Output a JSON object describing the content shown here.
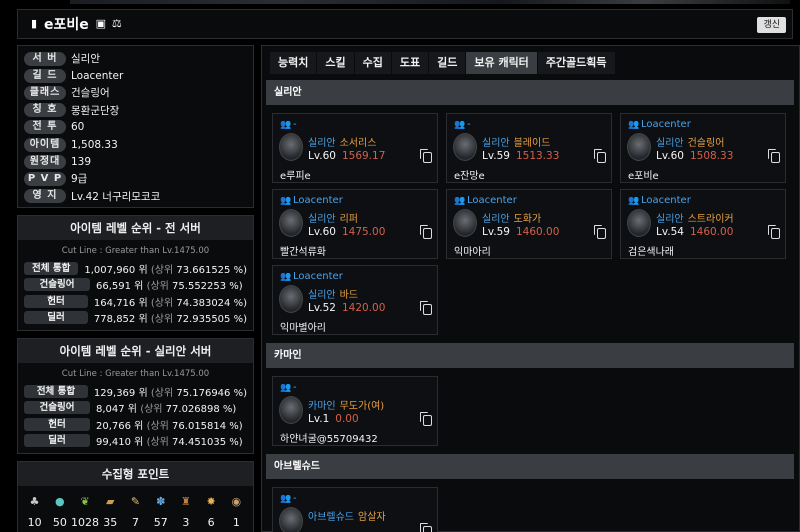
{
  "header": {
    "name": "e포비e",
    "refresh_label": "갱신"
  },
  "info": [
    {
      "key": "서 버",
      "value": "실리안"
    },
    {
      "key": "길 드",
      "value": "Loacenter"
    },
    {
      "key": "클래스",
      "value": "건슬링어"
    },
    {
      "key": "칭 호",
      "value": "몽환군단장"
    },
    {
      "key": "전 투",
      "value": "60"
    },
    {
      "key": "아이템",
      "value": "1,508.33"
    },
    {
      "key": "원정대",
      "value": "139"
    },
    {
      "key": "P V P",
      "value": "9급"
    },
    {
      "key": "영 지",
      "value": "Lv.42 너구리모코코"
    }
  ],
  "rank_all": {
    "title": "아이템 레벨 순위 - 전 서버",
    "cut": "Cut Line : Greater than Lv.1475.00",
    "rows": [
      {
        "key": "전체 통합",
        "rank": "1,007,960 위",
        "sub": "(상위",
        "pct": "73.661525 %)"
      },
      {
        "key": "건슬링어",
        "rank": "66,591 위",
        "sub": "(상위",
        "pct": "75.552253 %)"
      },
      {
        "key": "헌터",
        "rank": "164,716 위",
        "sub": "(상위",
        "pct": "74.383024 %)"
      },
      {
        "key": "딜러",
        "rank": "778,852 위",
        "sub": "(상위",
        "pct": "72.935505 %)"
      }
    ]
  },
  "rank_server": {
    "title": "아이템 레벨 순위 - 실리안 서버",
    "cut": "Cut Line : Greater than Lv.1475.00",
    "rows": [
      {
        "key": "전체 통합",
        "rank": "129,369 위",
        "sub": "(상위",
        "pct": "75.176946 %)"
      },
      {
        "key": "건슬링어",
        "rank": "8,047 위",
        "sub": "(상위",
        "pct": "77.026898 %)"
      },
      {
        "key": "헌터",
        "rank": "20,766 위",
        "sub": "(상위",
        "pct": "76.015814 %)"
      },
      {
        "key": "딜러",
        "rank": "99,410 위",
        "sub": "(상위",
        "pct": "74.451035 %)"
      }
    ]
  },
  "collect": {
    "title": "수집형 포인트",
    "items": [
      {
        "icon": "mokoko-seed-icon",
        "count": "10",
        "color": "#c8c8c8"
      },
      {
        "icon": "island-heart-icon",
        "count": "50",
        "color": "#5cc6c0"
      },
      {
        "icon": "giant-heart-icon",
        "count": "1028",
        "color": "#8ac04a"
      },
      {
        "icon": "art-icon",
        "count": "35",
        "color": "#c9a050"
      },
      {
        "icon": "voyage-icon",
        "count": "7",
        "color": "#e0c070"
      },
      {
        "icon": "world-tree-leaf-icon",
        "count": "57",
        "color": "#6ab0e8"
      },
      {
        "icon": "ignea-token-icon",
        "count": "3",
        "color": "#c08040"
      },
      {
        "icon": "orpheus-star-icon",
        "count": "6",
        "color": "#e8b050"
      },
      {
        "icon": "medal-icon",
        "count": "1",
        "color": "#c8a070"
      }
    ]
  },
  "tabs": [
    {
      "label": "능력치",
      "active": false
    },
    {
      "label": "스킬",
      "active": false
    },
    {
      "label": "수집",
      "active": false
    },
    {
      "label": "도표",
      "active": false
    },
    {
      "label": "길드",
      "active": false
    },
    {
      "label": "보유 캐릭터",
      "active": true
    },
    {
      "label": "주간골드획득",
      "active": false
    }
  ],
  "servers": [
    {
      "name": "실리안",
      "characters": [
        {
          "guild": "-",
          "server": "실리안",
          "class": "소서리스",
          "level": "Lv.60",
          "ilvl": "1569.17",
          "name": "e루피e"
        },
        {
          "guild": "-",
          "server": "실리안",
          "class": "블레이드",
          "level": "Lv.59",
          "ilvl": "1513.33",
          "name": "e잔망e"
        },
        {
          "guild": "Loacenter",
          "server": "실리안",
          "class": "건슬링어",
          "level": "Lv.60",
          "ilvl": "1508.33",
          "name": "e포비e"
        },
        {
          "guild": "Loacenter",
          "server": "실리안",
          "class": "리퍼",
          "level": "Lv.60",
          "ilvl": "1475.00",
          "name": "빨간석류화"
        },
        {
          "guild": "Loacenter",
          "server": "실리안",
          "class": "도화가",
          "level": "Lv.59",
          "ilvl": "1460.00",
          "name": "익마아리"
        },
        {
          "guild": "Loacenter",
          "server": "실리안",
          "class": "스트라이커",
          "level": "Lv.54",
          "ilvl": "1460.00",
          "name": "검은색나래"
        },
        {
          "guild": "Loacenter",
          "server": "실리안",
          "class": "바드",
          "level": "Lv.52",
          "ilvl": "1420.00",
          "name": "익마별아리"
        }
      ]
    },
    {
      "name": "카마인",
      "characters": [
        {
          "guild": "-",
          "server": "카마인",
          "class": "무도가(여)",
          "level": "Lv.1",
          "ilvl": "0.00",
          "name": "하얀녀굴@55709432"
        }
      ]
    },
    {
      "name": "아브렐슈드",
      "characters": [
        {
          "guild": "-",
          "server": "아브렐슈드",
          "class": "암살자",
          "level": "",
          "ilvl": "",
          "name": ""
        }
      ]
    }
  ]
}
